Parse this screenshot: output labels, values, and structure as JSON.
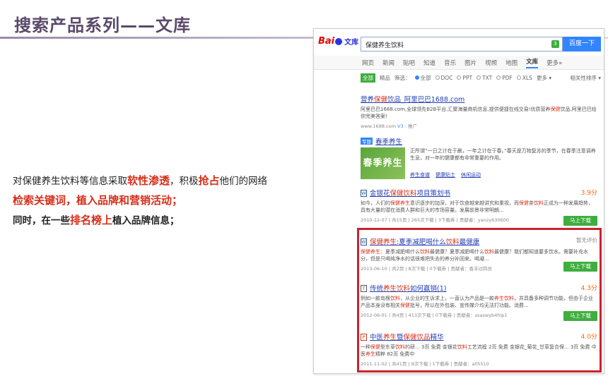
{
  "slide": {
    "title": "搜索产品系列——文库",
    "lines": [
      [
        {
          "text": "对保健养生饮料等信息采取",
          "style": "plain"
        },
        {
          "text": "软性渗透",
          "style": "red"
        },
        {
          "text": "，积极",
          "style": "plain"
        },
        {
          "text": "抢占",
          "style": "red"
        },
        {
          "text": "他们的网络",
          "style": "plain"
        }
      ],
      [
        {
          "text": "检索关键词，植入品牌和营销活动；",
          "style": "red"
        }
      ],
      [
        {
          "text": "同时，在一些",
          "style": "bold"
        },
        {
          "text": "排名榜上",
          "style": "red"
        },
        {
          "text": "植入品牌信息；",
          "style": "bold"
        }
      ]
    ]
  },
  "browser": {
    "logo_text": "Bai",
    "logo_text2": "文库",
    "search_value": "保健养生饮料",
    "search_clear_icon": "3",
    "search_button": "百度一下",
    "nav": [
      "网页",
      "新闻",
      "贴吧",
      "知道",
      "音乐",
      "图片",
      "视频",
      "地图",
      "文库",
      "更多»"
    ],
    "nav_active": 8,
    "filters": {
      "all": "全部",
      "items": [
        "精品",
        "筛选："
      ],
      "radios": [
        {
          "label": "全部",
          "checked": true
        },
        {
          "label": "DOC",
          "checked": false
        },
        {
          "label": "PPT",
          "checked": false
        },
        {
          "label": "TXT",
          "checked": false
        },
        {
          "label": "PDF",
          "checked": false
        },
        {
          "label": "XLS",
          "checked": false
        }
      ],
      "more": "更多 ▾",
      "sort": "相关性排序 ▾"
    },
    "ad_result": {
      "title_parts": [
        {
          "text": "营养",
          "hl": false
        },
        {
          "text": "保健",
          "hl": true
        },
        {
          "text": "饮品_阿里巴巴1688.com",
          "hl": false
        }
      ],
      "desc": "阿里巴巴1688.com,全球领先B2B平台,汇聚海量商机信息,提供便捷在线交易!优质营养保健饮品,阿里巴巴给你完美答案!",
      "meta": "www.1688.com",
      "meta_v": "V3",
      "meta_tag": "- 推广"
    },
    "spring_result": {
      "tag": "专题",
      "title": "春季养生",
      "image_text": "春季养生",
      "desc": "正所谓“一日之计在于晨，一年之计在于春。”春天是万物复苏的季节，在春季注意调养生息，对一年的健康都有非常重要的作用。",
      "links": [
        "养生食谱",
        "健康贴士",
        "休闲运动"
      ]
    },
    "results": [
      {
        "icon": "W",
        "title_parts": [
          {
            "text": "金银花",
            "hl": false
          },
          {
            "text": "保健饮料",
            "hl": true
          },
          {
            "text": "项目策划书",
            "hl": false
          }
        ],
        "score": "3.9分",
        "desc": "如今，人们的保健养生意识逐步的加深，对于饮食越来越讲究和重视，而保健茶饮料正成为一种发展趋势，具有大量的潜在消费人群和巨大的市场容量。发展前景非常明朗...",
        "meta": "2010-12-07 | 共15页 | 265次下载 | 3下载券 | 贡献者：yanzy630600",
        "download": "马上下载"
      },
      {
        "icon": "W",
        "title_parts": [
          {
            "text": "保健养生",
            "hl": true
          },
          {
            "text": ":夏季减肥喝什么",
            "hl": false
          },
          {
            "text": "饮料",
            "hl": true
          },
          {
            "text": "最健康",
            "hl": false
          }
        ],
        "score": "暂无评价",
        "desc": "保健养生：夏季减肥喝什么饮料最健康？夏季减肥喝什么饮料最健康？我们都知道要多饮水。需要补充水分，但是只喝纯净水的话很难把失去的养分补回来。喝凝...",
        "meta": "2013-06-10 | 共2页 | 8次下载 | 0下载券 | 贡献者：香丰过四员",
        "download": "马上下载"
      },
      {
        "icon": "T",
        "title_parts": [
          {
            "text": "传统",
            "hl": false
          },
          {
            "text": "养生饮料",
            "hl": true
          },
          {
            "text": "如何赢销(1)",
            "hl": false
          }
        ],
        "score": "4.3分",
        "desc": "例如一款岛根饮料，从企业的生诉求上，一直认为产品是一款养生饮料，并具备多种调节功能，但由于企业产品本身没有相关保健批号，所以在外包装、宣传媒介均无法打功能。消费...",
        "meta": "2012-06-01 | 共4页 | 413次下载 | 0下载券 | 贡献者：ssaswyb4hlp1",
        "download": "马上下载"
      },
      {
        "icon": "P",
        "title_parts": [
          {
            "text": "中医",
            "hl": false
          },
          {
            "text": "养生",
            "hl": true
          },
          {
            "text": "暨",
            "hl": false
          },
          {
            "text": "保健饮品",
            "hl": true
          },
          {
            "text": "精华",
            "hl": false
          }
        ],
        "score": "4.0分",
        "desc": "一种保健型东草饮料的研... 3页 免费 金银花饮料工艺流程 2页 免费 金银花_菊花_甘草复合保... 3页 免费 中医养生精粹 82页 免费中",
        "meta": "2011-11-02 | 共41页 | 8次下载 | 1下载券 | 贡献者：all5510",
        "download": ""
      }
    ]
  }
}
